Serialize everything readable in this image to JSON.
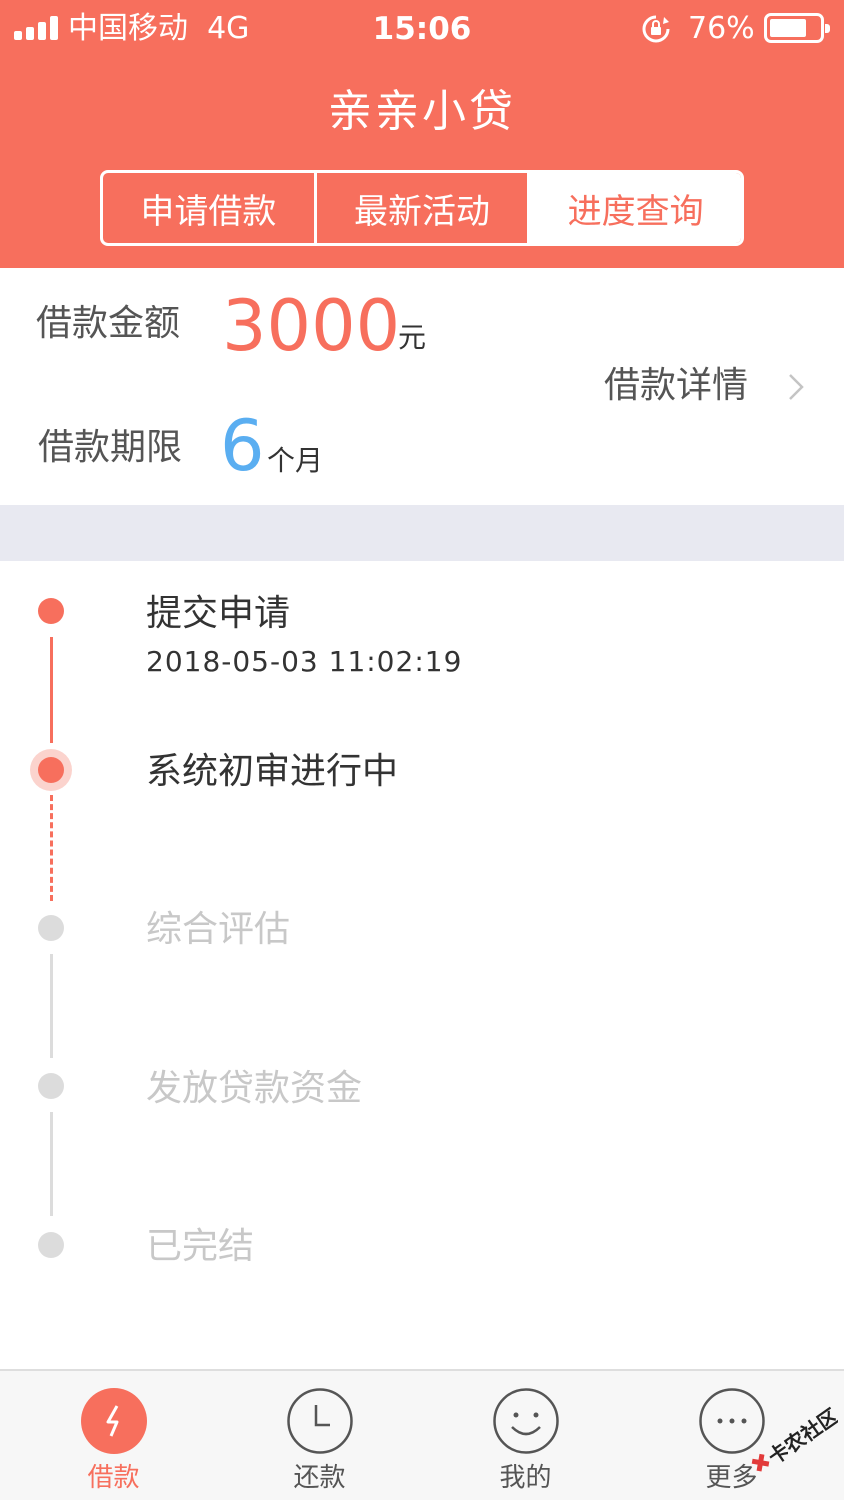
{
  "status_bar": {
    "carrier": "中国移动",
    "network": "4G",
    "time": "15:06",
    "battery_percent": "76%",
    "battery_level": 0.76
  },
  "header": {
    "title": "亲亲小贷",
    "tabs": [
      {
        "label": "申请借款",
        "selected": false
      },
      {
        "label": "最新活动",
        "selected": false
      },
      {
        "label": "进度查询",
        "selected": true
      }
    ]
  },
  "loan_summary": {
    "amount_label": "借款金额",
    "amount_value": "3000",
    "amount_unit": "元",
    "term_label": "借款期限",
    "term_value": "6",
    "term_unit": "个月",
    "details_link": "借款详情"
  },
  "progress": {
    "steps": [
      {
        "title": "提交申请",
        "time": "2018-05-03 11:02:19",
        "state": "done"
      },
      {
        "title": "系统初审进行中",
        "state": "current"
      },
      {
        "title": "综合评估",
        "state": "pending"
      },
      {
        "title": "发放贷款资金",
        "state": "pending"
      },
      {
        "title": "已完结",
        "state": "pending"
      }
    ]
  },
  "tab_bar": {
    "items": [
      {
        "label": "借款",
        "icon": "lightning-icon",
        "active": true
      },
      {
        "label": "还款",
        "icon": "clock-icon",
        "active": false
      },
      {
        "label": "我的",
        "icon": "smiley-icon",
        "active": false
      },
      {
        "label": "更多",
        "icon": "more-dots-icon",
        "active": false
      }
    ]
  },
  "watermark": "卡农社区",
  "colors": {
    "brand": "#f76f5d",
    "term_value": "#5aaef1",
    "separator": "#e8e9f1",
    "inactive_text": "#c8c8c8"
  }
}
